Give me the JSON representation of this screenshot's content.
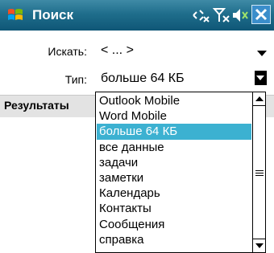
{
  "titlebar": {
    "title": "Поиск",
    "icons": [
      "windows-start-icon",
      "connectivity-icon",
      "signal-icon",
      "volume-muted-icon",
      "close-icon"
    ],
    "accent": "#1f6e8c"
  },
  "form": {
    "search_label": "Искать:",
    "search_value": "< ... >",
    "type_label": "Тип:",
    "type_value": "больше 64 КБ"
  },
  "results": {
    "label": "Результаты"
  },
  "dropdown": {
    "options": [
      "Outlook Mobile",
      "Word Mobile",
      "больше 64 КБ",
      "все данные",
      "задачи",
      "заметки",
      "Календарь",
      "Контакты",
      "Сообщения",
      "справка"
    ],
    "selected": "больше 64 КБ",
    "selection_color": "#3cb1d1"
  }
}
